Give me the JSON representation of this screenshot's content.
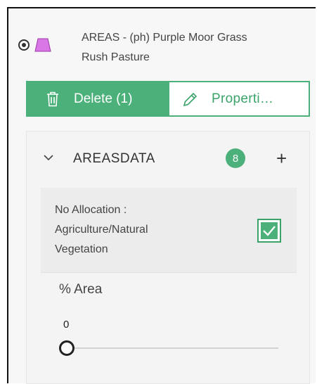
{
  "layer": {
    "name_line1": "AREAS - (ph) Purple Moor Grass",
    "name_line2": "Rush Pasture",
    "selected": true,
    "color": "#d977e6"
  },
  "actions": {
    "delete_label": "Delete (1)",
    "properties_label": "Properti…",
    "accent_color": "#4cb07a"
  },
  "group": {
    "title": "AREASDATA",
    "count": "8",
    "add_symbol": "+"
  },
  "allocation": {
    "line1": "No Allocation :",
    "line2": "Agriculture/Natural",
    "line3": "Vegetation",
    "checked": true
  },
  "area_field": {
    "label": "% Area",
    "value": "0",
    "value_fraction": 0
  }
}
